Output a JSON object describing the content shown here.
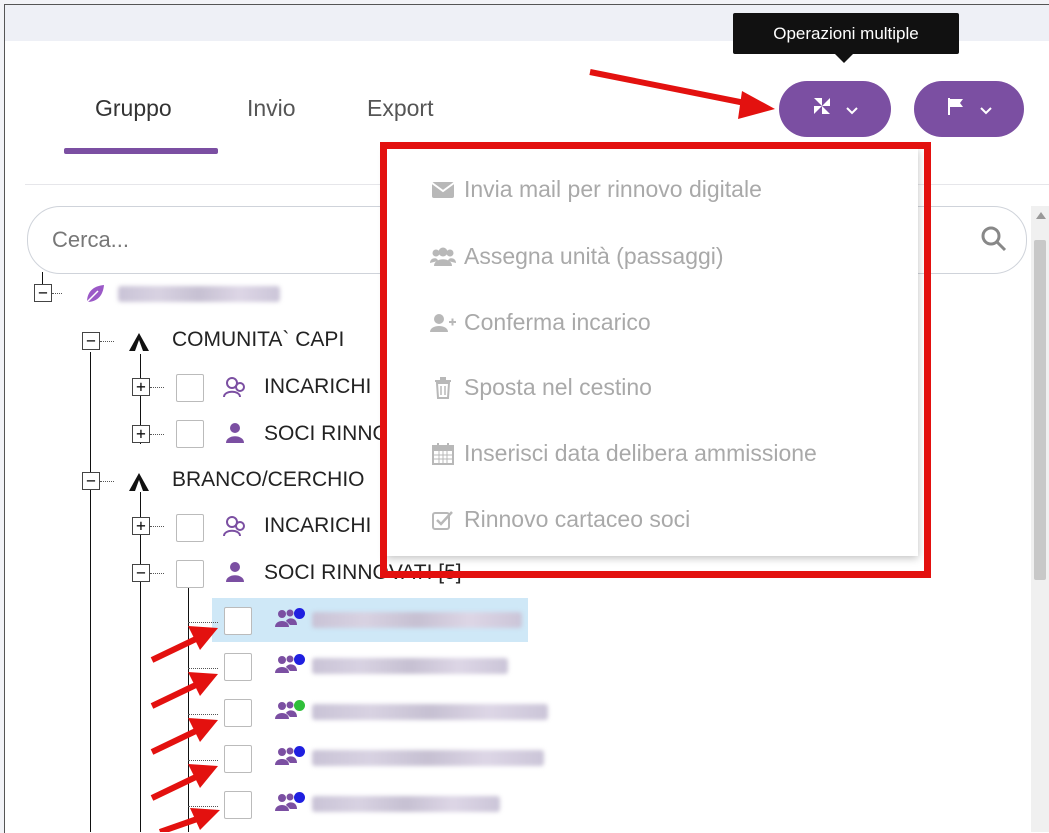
{
  "tooltip": "Operazioni multiple",
  "tabs": [
    {
      "label": "Gruppo",
      "active": true
    },
    {
      "label": "Invio",
      "active": false
    },
    {
      "label": "Export",
      "active": false
    }
  ],
  "search": {
    "placeholder": "Cerca..."
  },
  "tree": {
    "nodes": [
      {
        "label": "COMUNITA` CAPI"
      },
      {
        "label": "INCARICHI"
      },
      {
        "label": "SOCI RINNOVATI"
      },
      {
        "label": "BRANCO/CERCHIO"
      },
      {
        "label": "INCARICHI"
      },
      {
        "label": "SOCI RINNOVATI [5]"
      }
    ],
    "member_status_colors": [
      "#1f1fe0",
      "#1f1fe0",
      "#2fbf3a",
      "#1f1fe0",
      "#1f1fe0"
    ]
  },
  "dropdown": {
    "items": [
      {
        "icon": "envelope-icon",
        "label": "Invia mail per rinnovo digitale"
      },
      {
        "icon": "users-icon",
        "label": "Assegna unità (passaggi)"
      },
      {
        "icon": "user-plus-icon",
        "label": "Conferma incarico"
      },
      {
        "icon": "trash-icon",
        "label": "Sposta nel cestino"
      },
      {
        "icon": "calendar-icon",
        "label": "Inserisci data delibera ammissione"
      },
      {
        "icon": "checkbox-icon",
        "label": "Rinnovo cartaceo soci"
      }
    ]
  },
  "colors": {
    "accent": "#7b4fa2",
    "highlight": "#e3110f",
    "disabled_text": "#a9a9a9"
  }
}
